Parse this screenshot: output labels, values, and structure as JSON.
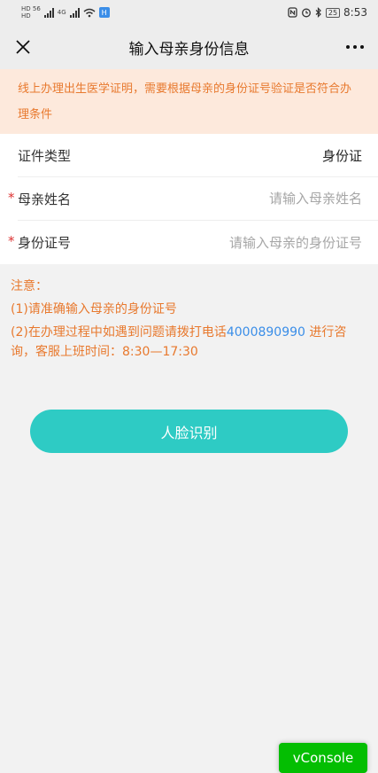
{
  "status_bar": {
    "left_tiny_top": "HD 56",
    "left_tiny_bottom": "HD",
    "network_4g": "4G",
    "app_icon": "H",
    "battery": "25",
    "time": "8:53"
  },
  "nav": {
    "title": "输入母亲身份信息"
  },
  "notice": "线上办理出生医学证明，需要根据母亲的身份证号验证是否符合办理条件",
  "form": {
    "id_type_label": "证件类型",
    "id_type_value": "身份证",
    "name_label": "母亲姓名",
    "name_placeholder": "请输入母亲姓名",
    "idno_label": "身份证号",
    "idno_placeholder": "请输入母亲的身份证号",
    "required_mark": "*"
  },
  "note": {
    "title": "注意：",
    "item1": "(1)请准确输入母亲的身份证号",
    "item2_prefix": "(2)在办理过程中如遇到问题请拨打电话",
    "phone": "4000890990",
    "item2_suffix": " 进行咨询，客服上班时间：8:30—17:30"
  },
  "face_button": "人脸识别",
  "vconsole": "vConsole",
  "colors": {
    "accent": "#2ecbc4",
    "warning_text": "#e8792e",
    "notice_bg": "#fde9dc",
    "link": "#3b8ee8",
    "vconsole": "#04be02"
  }
}
